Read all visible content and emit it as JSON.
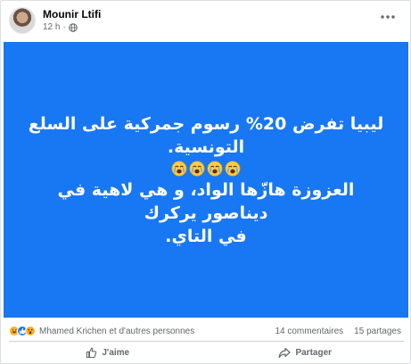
{
  "post": {
    "author": "Mounir Ltifi",
    "time": "12 h",
    "separator": "·",
    "text_lines_1": "ليبيا تفرض 20% رسوم جمركية على السلع\nالتونسية.",
    "text_lines_2": "العزوزة هازّها الواد، و هي لاهية في ديناصور يركرك\nفي التاي.",
    "emoji": [
      "crying-face",
      "crying-face",
      "crying-face",
      "crying-face"
    ],
    "background_color": "#1877f2"
  },
  "reactions": {
    "icons": [
      "haha-icon",
      "like-icon",
      "wow-icon"
    ],
    "reactors": "Mhamed Krichen et d'autres personnes",
    "comments": "14 commentaires",
    "shares": "15 partages"
  },
  "actions": {
    "like_label": "J'aime",
    "share_label": "Partager"
  }
}
